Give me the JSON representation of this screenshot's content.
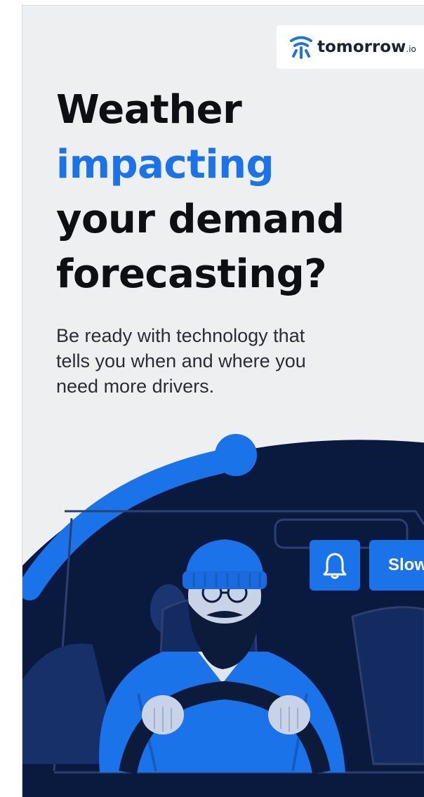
{
  "brand": {
    "name": "tomorrow",
    "tld": ".io",
    "icon": "tomorrow-logo-icon"
  },
  "headline": {
    "line1": "Weather",
    "line2": "impacting",
    "line3": "your demand",
    "line4": "forecasting?"
  },
  "subtext": {
    "line1": "Be ready with technology that",
    "line2": "tells you when and where you",
    "line3": "need more drivers."
  },
  "illustration": {
    "alert_icon": "bell-icon",
    "alert_text": "Slow"
  },
  "colors": {
    "background": "#eeeff1",
    "accent": "#1a73e8",
    "navy": "#0a1a3f",
    "headline": "#0d0f12"
  }
}
